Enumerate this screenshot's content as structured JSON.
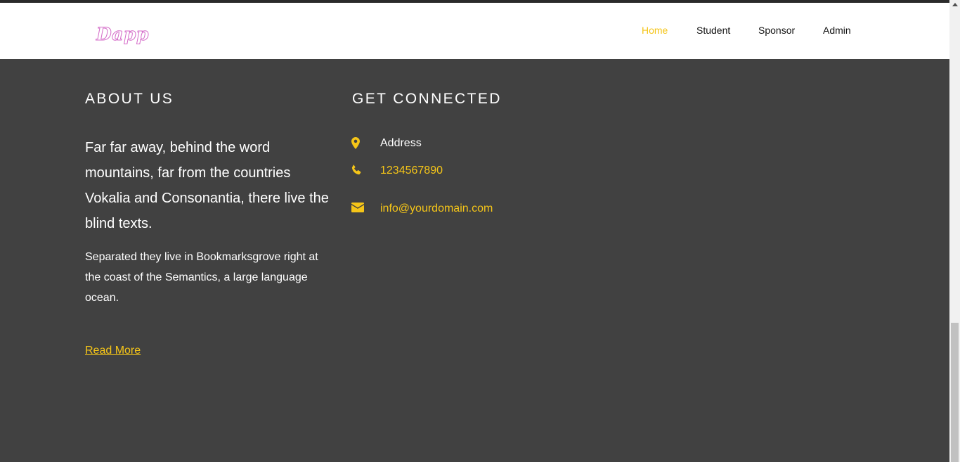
{
  "brand": {
    "logo_text": "Dapp"
  },
  "nav": {
    "items": [
      {
        "label": "Home",
        "active": true
      },
      {
        "label": "Student",
        "active": false
      },
      {
        "label": "Sponsor",
        "active": false
      },
      {
        "label": "Admin",
        "active": false
      }
    ]
  },
  "about": {
    "heading": "ABOUT US",
    "lead": "Far far away, behind the word mountains, far from the countries Vokalia and Consonantia, there live the blind texts.",
    "paragraph": "Separated they live in Bookmarksgrove right at the coast of the Semantics, a large language ocean.",
    "read_more": "Read More"
  },
  "connect": {
    "heading": "GET CONNECTED",
    "address_label": "Address",
    "phone": "1234567890",
    "email": "info@yourdomain.com"
  },
  "colors": {
    "accent": "#f5c518",
    "footer_bg": "#414141",
    "logo_outline": "#d46bc8"
  },
  "icons": {
    "address": "map-marker-icon",
    "phone": "phone-icon",
    "email": "envelope-icon"
  }
}
